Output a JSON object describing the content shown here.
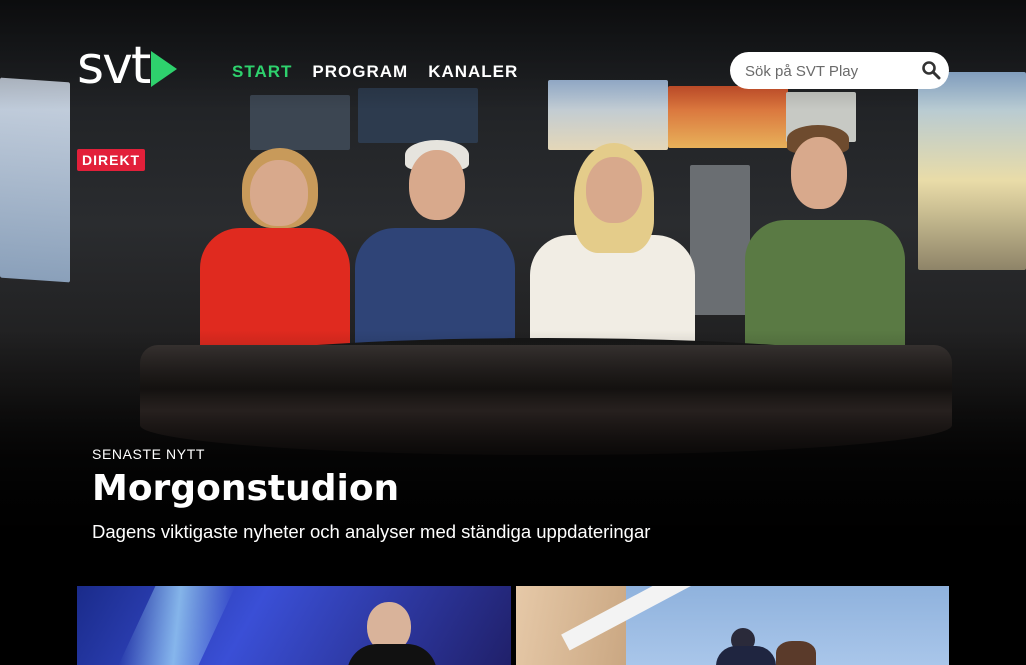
{
  "header": {
    "logo_text": "svt",
    "nav": [
      {
        "label": "START",
        "active": true
      },
      {
        "label": "PROGRAM",
        "active": false
      },
      {
        "label": "KANALER",
        "active": false
      }
    ],
    "search_placeholder": "Sök på SVT Play"
  },
  "hero": {
    "live_badge": "DIREKT",
    "kicker": "SENASTE NYTT",
    "title": "Morgonstudion",
    "description": "Dagens viktigaste nyheter och analyser med ständiga uppdateringar"
  },
  "colors": {
    "accent": "#2ed16d",
    "live": "#e2203a",
    "background": "#000000"
  },
  "icons": {
    "search": "search-icon",
    "logo": "play-triangle-icon"
  }
}
